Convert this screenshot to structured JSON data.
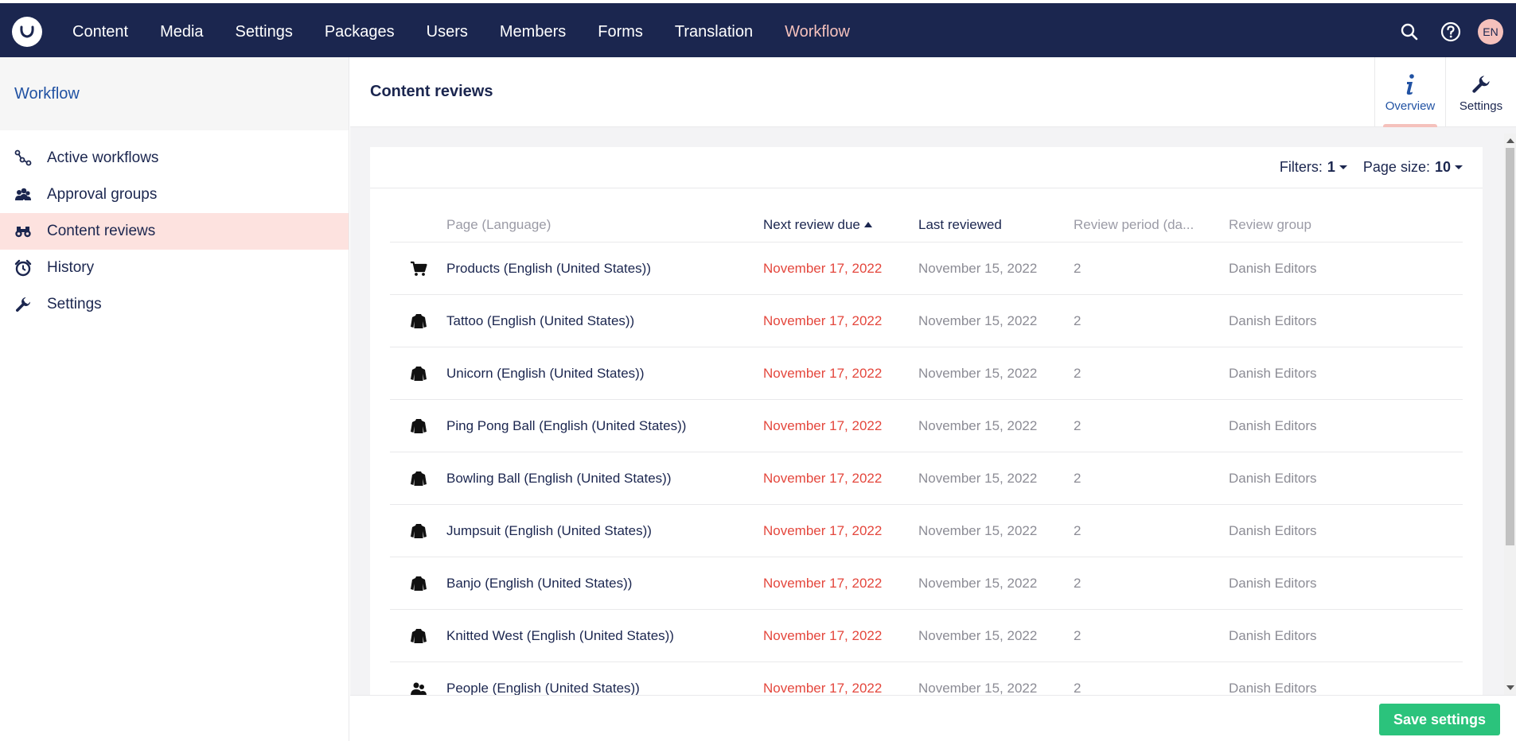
{
  "topnav": {
    "items": [
      {
        "label": "Content"
      },
      {
        "label": "Media"
      },
      {
        "label": "Settings"
      },
      {
        "label": "Packages"
      },
      {
        "label": "Users"
      },
      {
        "label": "Members"
      },
      {
        "label": "Forms"
      },
      {
        "label": "Translation"
      },
      {
        "label": "Workflow",
        "active": true
      }
    ],
    "avatar": "EN",
    "icons": [
      "search-icon",
      "help-icon"
    ]
  },
  "sidebar": {
    "title": "Workflow",
    "items": [
      {
        "label": "Active workflows",
        "icon": "workflow-icon"
      },
      {
        "label": "Approval groups",
        "icon": "users-icon"
      },
      {
        "label": "Content reviews",
        "icon": "binoculars-icon",
        "active": true
      },
      {
        "label": "History",
        "icon": "alarm-clock-icon"
      },
      {
        "label": "Settings",
        "icon": "wrench-icon"
      }
    ]
  },
  "main": {
    "title": "Content reviews",
    "apps": [
      {
        "label": "Overview",
        "icon": "info-icon",
        "active": true
      },
      {
        "label": "Settings",
        "icon": "wrench-icon"
      }
    ]
  },
  "toolbar": {
    "filters_label": "Filters:",
    "filters_value": "1",
    "page_size_label": "Page size:",
    "page_size_value": "10"
  },
  "table": {
    "columns": [
      "Page (Language)",
      "Next review due",
      "Last reviewed",
      "Review period (da...",
      "Review group"
    ],
    "rows": [
      {
        "icon": "cart-icon",
        "page": "Products (English (United States))",
        "next": "November 17, 2022",
        "last": "November 15, 2022",
        "period": "2",
        "group": "Danish Editors"
      },
      {
        "icon": "shirt-icon",
        "page": "Tattoo (English (United States))",
        "next": "November 17, 2022",
        "last": "November 15, 2022",
        "period": "2",
        "group": "Danish Editors"
      },
      {
        "icon": "shirt-icon",
        "page": "Unicorn (English (United States))",
        "next": "November 17, 2022",
        "last": "November 15, 2022",
        "period": "2",
        "group": "Danish Editors"
      },
      {
        "icon": "shirt-icon",
        "page": "Ping Pong Ball (English (United States))",
        "next": "November 17, 2022",
        "last": "November 15, 2022",
        "period": "2",
        "group": "Danish Editors"
      },
      {
        "icon": "shirt-icon",
        "page": "Bowling Ball (English (United States))",
        "next": "November 17, 2022",
        "last": "November 15, 2022",
        "period": "2",
        "group": "Danish Editors"
      },
      {
        "icon": "shirt-icon",
        "page": "Jumpsuit (English (United States))",
        "next": "November 17, 2022",
        "last": "November 15, 2022",
        "period": "2",
        "group": "Danish Editors"
      },
      {
        "icon": "shirt-icon",
        "page": "Banjo (English (United States))",
        "next": "November 17, 2022",
        "last": "November 15, 2022",
        "period": "2",
        "group": "Danish Editors"
      },
      {
        "icon": "shirt-icon",
        "page": "Knitted West (English (United States))",
        "next": "November 17, 2022",
        "last": "November 15, 2022",
        "period": "2",
        "group": "Danish Editors"
      },
      {
        "icon": "people-icon",
        "page": "People (English (United States))",
        "next": "November 17, 2022",
        "last": "November 15, 2022",
        "period": "2",
        "group": "Danish Editors"
      }
    ]
  },
  "footer": {
    "save_label": "Save settings"
  },
  "colors": {
    "topbar": "#1b264f",
    "active_nav": "#f5c1bc",
    "overdue": "#e4473d",
    "save_button": "#2bc37c",
    "active_sidebar": "#fde2df"
  }
}
